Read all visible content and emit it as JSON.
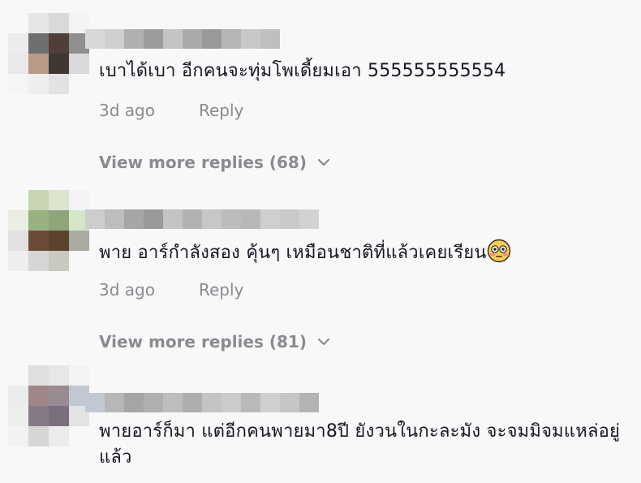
{
  "comments": [
    {
      "text": "เบาได้เบา อีกคนจะทุ่มโพเดี้ยมเอา 555555555554",
      "date": "3d ago",
      "reply_label": "Reply",
      "more_replies": "View more replies (68)",
      "avatar_colors": [
        "#f8f8f8",
        "#e6e6e6",
        "#d9d9d9",
        "#f3f3f3",
        "#ececec",
        "#6f6f6f",
        "#4e4038",
        "#8f8f8f",
        "#e9e9e9",
        "#b89a87",
        "#3e3733",
        "#d9d9d9",
        "#f5f5f5",
        "#eeeeee",
        "#e2e2e2",
        "#f8f8f8"
      ],
      "username_colors": [
        "#d8d8d8",
        "#cfcfcf",
        "#b0b0b0",
        "#9c9c9c",
        "#c4c4c4",
        "#aaaaaa",
        "#999999",
        "#b5b5b5",
        "#c8c8c8",
        "#bfbfbf"
      ]
    },
    {
      "text": "พาย อาร์กำลังสอง คุ้นๆ เหมือนชาติที่แล้วเคยเรียน",
      "emoji": "flushed-face",
      "date": "3d ago",
      "reply_label": "Reply",
      "more_replies": "View more replies (81)",
      "avatar_colors": [
        "#f8f8f8",
        "#c6d5b4",
        "#dbe4cd",
        "#f4f4f4",
        "#e8eee0",
        "#97b27f",
        "#8fa57a",
        "#d4e7c8",
        "#e1e1e1",
        "#6d4a37",
        "#5c4330",
        "#a9aba0",
        "#eeeeee",
        "#d6d6d6",
        "#c9c9c0",
        "#f8f8f8"
      ],
      "username_colors": [
        "#cdcdcd",
        "#bdbdbd",
        "#a6a6a6",
        "#9a9a9a",
        "#c3c3c3",
        "#b2b2b2",
        "#c7c7c7",
        "#bcbcbc",
        "#b8b8b8",
        "#cfcfcf",
        "#c9c9c9",
        "#d2d2d2"
      ]
    },
    {
      "text": "พายอาร์ก็มา แต่อีกคนพายมา8ปี ยังวนในกะละมัง จะจมมิจมแหล่อยู่แล้ว",
      "avatar_colors": [
        "#f8f8f8",
        "#e0dede",
        "#e7e7e7",
        "#f3f3f3",
        "#ececec",
        "#a08686",
        "#9a8a92",
        "#c2c8d2",
        "#eeeeee",
        "#857b86",
        "#7b6f7e",
        "#e3e3e3",
        "#f2f2f2",
        "#d6d6d6",
        "#ececec",
        "#f8f8f8"
      ],
      "username_colors": [
        "#c2c8d2",
        "#b7b7b7",
        "#a5a5a5",
        "#b0b0b0",
        "#bdbdbd",
        "#aeaeae",
        "#c4c4c4",
        "#cbcbcb",
        "#b9b9b9",
        "#d0d0d0",
        "#c6c6c6",
        "#b3b3b3"
      ]
    }
  ]
}
